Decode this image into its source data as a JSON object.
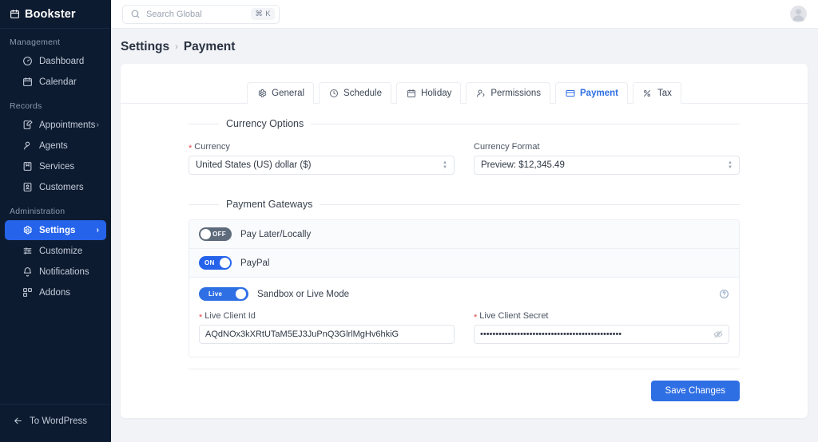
{
  "sidebar": {
    "brand": {
      "label": "Bookster",
      "icon": "calendar-icon"
    },
    "sections": [
      {
        "title": "Management",
        "items": [
          {
            "label": "Dashboard",
            "icon": "gauge-icon",
            "active": false,
            "chevron": false
          },
          {
            "label": "Calendar",
            "icon": "calendar-icon",
            "active": false,
            "chevron": false
          }
        ]
      },
      {
        "title": "Records",
        "items": [
          {
            "label": "Appointments",
            "icon": "note-edit-icon",
            "active": false,
            "chevron": true
          },
          {
            "label": "Agents",
            "icon": "user-icon",
            "active": false,
            "chevron": false
          },
          {
            "label": "Services",
            "icon": "bookmark-icon",
            "active": false,
            "chevron": false
          },
          {
            "label": "Customers",
            "icon": "contact-card-icon",
            "active": false,
            "chevron": false
          }
        ]
      },
      {
        "title": "Administration",
        "items": [
          {
            "label": "Settings",
            "icon": "gear-icon",
            "active": true,
            "chevron": true
          },
          {
            "label": "Customize",
            "icon": "sliders-icon",
            "active": false,
            "chevron": false
          },
          {
            "label": "Notifications",
            "icon": "bell-icon",
            "active": false,
            "chevron": false
          },
          {
            "label": "Addons",
            "icon": "blocks-icon",
            "active": false,
            "chevron": false
          }
        ]
      }
    ],
    "footer": {
      "label": "To WordPress",
      "icon": "arrow-left-icon"
    },
    "active_color": "#2563eb",
    "background_color": "#0d1b30"
  },
  "topbar": {
    "search": {
      "placeholder": "Search Global",
      "value": "",
      "icon": "search-icon",
      "shortcut": "⌘ K"
    },
    "avatar": "user-avatar"
  },
  "breadcrumb": {
    "parent": "Settings",
    "separator": "›",
    "current": "Payment"
  },
  "tabs": [
    {
      "label": "General",
      "icon": "gear-icon",
      "active": false
    },
    {
      "label": "Schedule",
      "icon": "clock-icon",
      "active": false
    },
    {
      "label": "Holiday",
      "icon": "calendar-icon",
      "active": false
    },
    {
      "label": "Permissions",
      "icon": "users-icon",
      "active": false
    },
    {
      "label": "Payment",
      "icon": "credit-card-icon",
      "active": true
    },
    {
      "label": "Tax",
      "icon": "percent-icon",
      "active": false
    }
  ],
  "currency_section": {
    "title": "Currency Options",
    "currency": {
      "label": "Currency",
      "required": true,
      "value": "United States (US) dollar ($)"
    },
    "currency_format": {
      "label": "Currency Format",
      "required": false,
      "value": "Preview: $12,345.49"
    }
  },
  "gateways_section": {
    "title": "Payment Gateways",
    "rows": [
      {
        "label": "Pay Later/Locally",
        "toggle_state": "OFF",
        "enabled": false
      },
      {
        "label": "PayPal",
        "toggle_state": "ON",
        "enabled": true
      }
    ],
    "paypal_panel": {
      "mode_toggle_label": "Live",
      "mode_label": "Sandbox or Live Mode",
      "help_icon": "question-circle-icon",
      "client_id": {
        "label": "Live Client Id",
        "required": true,
        "value": "AQdNOx3kXRtUTaM5EJ3JuPnQ3GlrlMgHv6hkiG"
      },
      "client_secret": {
        "label": "Live Client Secret",
        "required": true,
        "value": "••••••••••••••••••••••••••••••••••••••••••••••",
        "reveal_icon": "eye-off-icon"
      }
    }
  },
  "actions": {
    "save_label": "Save Changes",
    "primary_color": "#2f6fe4"
  }
}
